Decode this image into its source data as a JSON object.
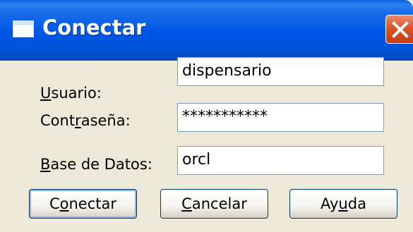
{
  "window": {
    "title": "Conectar",
    "close_icon": "close-x-icon",
    "title_icon": "window-icon"
  },
  "form": {
    "usuario": {
      "label_accel": "U",
      "label_rest": "suario:",
      "value": "dispensario"
    },
    "contrasena": {
      "label_pre": "Cont",
      "label_accel": "r",
      "label_rest": "aseña:",
      "value": "***********"
    },
    "base_datos": {
      "label_accel": "B",
      "label_rest": "ase de Datos:",
      "value": "orcl"
    }
  },
  "buttons": {
    "conectar": {
      "pre": "C",
      "accel": "o",
      "rest": "nectar"
    },
    "cancelar": {
      "pre": "",
      "accel": "C",
      "rest": "ancelar"
    },
    "ayuda": {
      "pre": "Ay",
      "accel": "u",
      "rest": "da"
    }
  },
  "colors": {
    "titlebar": "#0058e6",
    "close_button": "#d9542c",
    "dialog_bg": "#ece9d8"
  }
}
